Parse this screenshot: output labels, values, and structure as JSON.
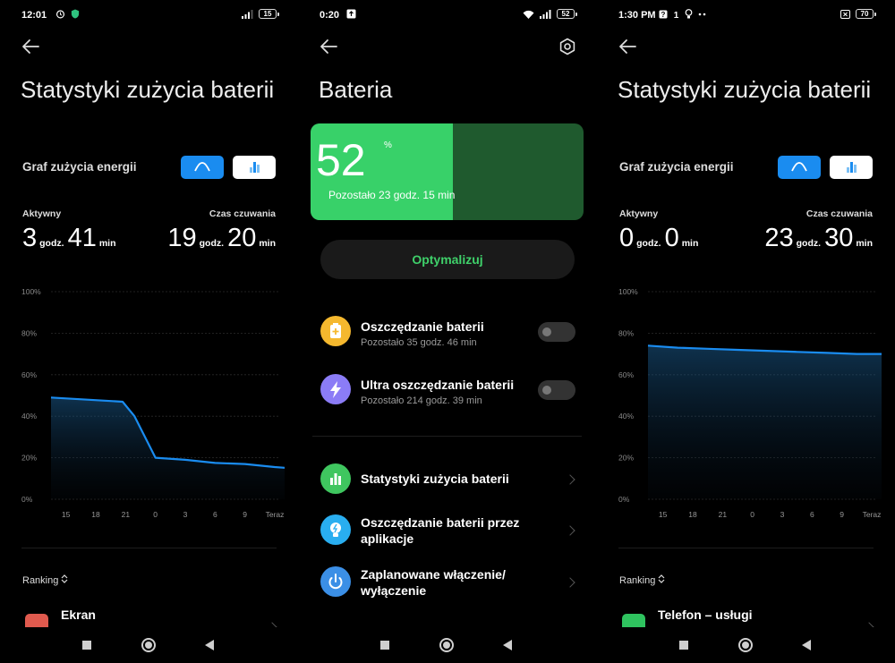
{
  "panel1": {
    "status": {
      "time": "12:01",
      "battery": "15"
    },
    "title": "Statystyki zużycia baterii",
    "graph_label": "Graf zużycia energii",
    "active": {
      "label": "Aktywny",
      "hours": "3",
      "h_unit": "godz.",
      "minutes": "41",
      "m_unit": "min"
    },
    "standby": {
      "label": "Czas czuwania",
      "hours": "19",
      "h_unit": "godz.",
      "minutes": "20",
      "m_unit": "min"
    },
    "ranking": "Ranking",
    "ranking_icon": "swap-vertical-icon",
    "rank_first": "Ekran",
    "chart_data": {
      "type": "area",
      "y_ticks": [
        "100%",
        "80%",
        "60%",
        "40%",
        "20%",
        "0%"
      ],
      "x_ticks": [
        "15",
        "18",
        "21",
        "0",
        "3",
        "6",
        "9",
        "Teraz"
      ],
      "ylim": [
        0,
        100
      ],
      "x": [
        0,
        1.8,
        2.4,
        2.8,
        3.5,
        4.5,
        5.5,
        6.5,
        7.5,
        8.0
      ],
      "values": [
        49,
        47.5,
        47,
        40,
        20,
        19,
        17.5,
        17,
        15.5,
        15
      ],
      "grid": true,
      "color": "#1a8cf0"
    }
  },
  "panel2": {
    "status": {
      "time": "0:20",
      "battery": "52"
    },
    "title": "Bateria",
    "battery_percent": "52",
    "percent_sign": "%",
    "battery_level": 0.52,
    "remaining": "Pozostało 23 godz. 15 min",
    "optimize": "Optymalizuj",
    "items": [
      {
        "title": "Oszczędzanie baterii",
        "sub": "Pozostało 35 godz. 46 min",
        "icon": "battery-saver-icon",
        "color": "#f5b82e"
      },
      {
        "title": "Ultra oszczędzanie baterii",
        "sub": "Pozostało 214 godz. 39 min",
        "icon": "lightning-icon",
        "color": "#8b7cf6"
      },
      {
        "title": "Statystyki zużycia baterii",
        "icon": "bar-chart-icon",
        "color": "#3fc65f"
      },
      {
        "title": "Oszczędzanie baterii przez aplikacje",
        "icon": "lightbulb-icon",
        "color": "#29aef0"
      },
      {
        "title": "Zaplanowane włączenie/ wyłączenie",
        "icon": "power-icon",
        "color": "#3b8fe6"
      }
    ]
  },
  "panel3": {
    "status": {
      "time": "1:30 PM",
      "battery": "70"
    },
    "title": "Statystyki zużycia baterii",
    "graph_label": "Graf zużycia energii",
    "active": {
      "label": "Aktywny",
      "hours": "0",
      "h_unit": "godz.",
      "minutes": "0",
      "m_unit": "min"
    },
    "standby": {
      "label": "Czas czuwania",
      "hours": "23",
      "h_unit": "godz.",
      "minutes": "30",
      "m_unit": "min"
    },
    "ranking": "Ranking",
    "ranking_icon": "swap-vertical-icon",
    "rank_first": "Telefon – usługi",
    "chart_data": {
      "type": "area",
      "y_ticks": [
        "100%",
        "80%",
        "60%",
        "40%",
        "20%",
        "0%"
      ],
      "x_ticks": [
        "15",
        "18",
        "21",
        "0",
        "3",
        "6",
        "9",
        "Teraz"
      ],
      "ylim": [
        0,
        100
      ],
      "x": [
        0,
        1,
        2,
        3,
        4,
        5,
        6,
        7,
        8
      ],
      "values": [
        74,
        73,
        72.5,
        72,
        71.5,
        71,
        70.5,
        70,
        70
      ],
      "grid": true,
      "color": "#1a8cf0"
    }
  }
}
